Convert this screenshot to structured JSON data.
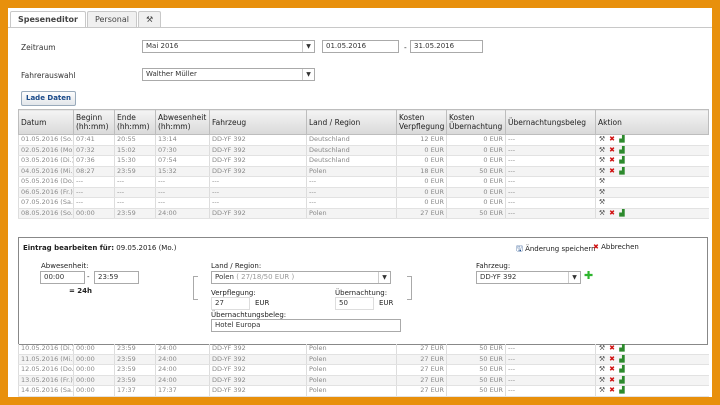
{
  "tabs": [
    {
      "label": "Speseneditor",
      "active": true
    },
    {
      "label": "Personal",
      "active": false
    },
    {
      "icon": "tools-icon"
    }
  ],
  "filter": {
    "zeitraum_label": "Zeitraum",
    "zeitraum_value": "Mai 2016",
    "date_from": "01.05.2016",
    "date_sep": "-",
    "date_to": "31.05.2016",
    "fahrer_label": "Fahrerauswahl",
    "fahrer_value": "Walther Müller",
    "load_button": "Lade Daten"
  },
  "table": {
    "headers": [
      "Datum",
      "Beginn (hh:mm)",
      "Ende (hh:mm)",
      "Abwesenheit (hh:mm)",
      "Fahrzeug",
      "Land / Region",
      "Kosten Verpflegung",
      "Kosten Übernachtung",
      "Übernachtungsbeleg",
      "Aktion"
    ],
    "rows_top": [
      [
        "01.05.2016 (So.)",
        "07:41",
        "20:55",
        "13:14",
        "DD-YF 392",
        "Deutschland",
        "12 EUR",
        "0 EUR",
        "---",
        "full"
      ],
      [
        "02.05.2016 (Mo.)",
        "07:32",
        "15:02",
        "07:30",
        "DD-YF 392",
        "Deutschland",
        "0 EUR",
        "0 EUR",
        "---",
        "full"
      ],
      [
        "03.05.2016 (Di.)",
        "07:36",
        "15:30",
        "07:54",
        "DD-YF 392",
        "Deutschland",
        "0 EUR",
        "0 EUR",
        "---",
        "full"
      ],
      [
        "04.05.2016 (Mi.)",
        "08:27",
        "23:59",
        "15:32",
        "DD-YF 392",
        "Polen",
        "18 EUR",
        "50 EUR",
        "---",
        "full"
      ],
      [
        "05.05.2016 (Do.)",
        "---",
        "---",
        "---",
        "---",
        "---",
        "0 EUR",
        "0 EUR",
        "---",
        "tool"
      ],
      [
        "06.05.2016 (Fr.)",
        "---",
        "---",
        "---",
        "---",
        "---",
        "0 EUR",
        "0 EUR",
        "---",
        "tool"
      ],
      [
        "07.05.2016 (Sa.)",
        "---",
        "---",
        "---",
        "---",
        "---",
        "0 EUR",
        "0 EUR",
        "---",
        "tool"
      ],
      [
        "08.05.2016 (So.)",
        "00:00",
        "23:59",
        "24:00",
        "DD-YF 392",
        "Polen",
        "27 EUR",
        "50 EUR",
        "---",
        "full"
      ]
    ],
    "rows_bottom": [
      [
        "10.05.2016 (Di.)",
        "00:00",
        "23:59",
        "24:00",
        "DD-YF 392",
        "Polen",
        "27 EUR",
        "50 EUR",
        "---",
        "full"
      ],
      [
        "11.05.2016 (Mi.)",
        "00:00",
        "23:59",
        "24:00",
        "DD-YF 392",
        "Polen",
        "27 EUR",
        "50 EUR",
        "---",
        "full"
      ],
      [
        "12.05.2016 (Do.)",
        "00:00",
        "23:59",
        "24:00",
        "DD-YF 392",
        "Polen",
        "27 EUR",
        "50 EUR",
        "---",
        "full"
      ],
      [
        "13.05.2016 (Fr.)",
        "00:00",
        "23:59",
        "24:00",
        "DD-YF 392",
        "Polen",
        "27 EUR",
        "50 EUR",
        "---",
        "full"
      ],
      [
        "14.05.2016 (Sa.)",
        "00:00",
        "17:37",
        "17:37",
        "DD-YF 392",
        "Polen",
        "27 EUR",
        "50 EUR",
        "---",
        "full"
      ]
    ]
  },
  "edit": {
    "title_prefix": "Eintrag bearbeiten für:",
    "title_date": "09.05.2016 (Mo.)",
    "save_label": "Änderung speichern",
    "cancel_label": "Abbrechen",
    "abwesenheit_label": "Abwesenheit:",
    "time_from": "00:00",
    "time_sep": "-",
    "time_to": "23:59",
    "duration": "= 24h",
    "land_label": "Land / Region:",
    "land_value": "Polen",
    "land_rates": "( 27/18/50 EUR )",
    "verpflegung_label": "Verpflegung:",
    "verpflegung_value": "27",
    "verpflegung_unit": "EUR",
    "uebernachtung_label": "Übernachtung:",
    "uebernachtung_value": "50",
    "uebernachtung_unit": "EUR",
    "beleg_label": "Übernachtungsbeleg:",
    "beleg_value": "Hotel Europa",
    "fahrzeug_label": "Fahrzeug:",
    "fahrzeug_value": "DD-YF 392"
  }
}
